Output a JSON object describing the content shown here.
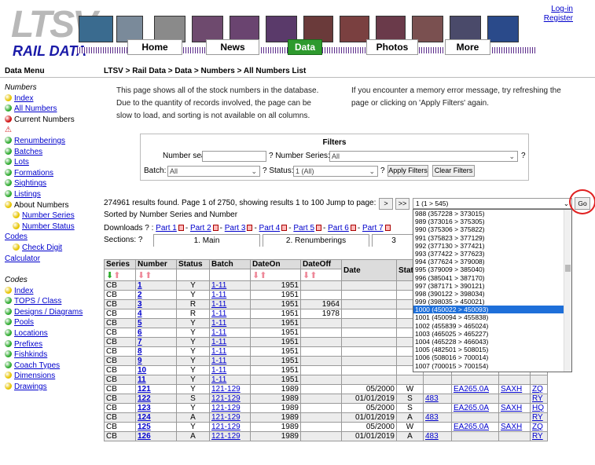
{
  "header": {
    "logo_main": "LTSV",
    "logo_sub": "RAIL DATA",
    "tabs": [
      "Home",
      "News",
      "Data",
      "Photos",
      "More"
    ],
    "login": "Log-in",
    "register": "Register"
  },
  "menu": {
    "title": "Data Menu",
    "sec1": "Numbers",
    "items1": [
      {
        "label": "Index",
        "dot": "yellow",
        "link": true
      },
      {
        "label": "All Numbers",
        "dot": "green",
        "link": true
      },
      {
        "label": "Current Numbers",
        "dot": "red",
        "link": false
      },
      {
        "label": "",
        "dot": "warn",
        "link": false
      },
      {
        "label": "Renumberings",
        "dot": "green",
        "link": true
      },
      {
        "label": "Batches",
        "dot": "green",
        "link": true
      },
      {
        "label": "Lots",
        "dot": "green",
        "link": true
      },
      {
        "label": "Formations",
        "dot": "green",
        "link": true
      },
      {
        "label": "Sightings",
        "dot": "green",
        "link": true
      },
      {
        "label": "Listings",
        "dot": "green",
        "link": true
      },
      {
        "label": "About Numbers",
        "dot": "yellow",
        "link": false
      },
      {
        "label": "Number Series",
        "dot": "yellow",
        "link": true,
        "indent": true
      },
      {
        "label": "Number Status",
        "dot": "yellow",
        "link": true,
        "indent": true
      },
      {
        "label": "Codes",
        "dot": "",
        "link": true
      },
      {
        "label": "Check Digit",
        "dot": "yellow",
        "link": true,
        "indent": true
      },
      {
        "label": "Calculator",
        "dot": "",
        "link": true
      }
    ],
    "sec2": "Codes",
    "items2": [
      {
        "label": "Index",
        "dot": "yellow"
      },
      {
        "label": "TOPS / Class",
        "dot": "green"
      },
      {
        "label": "Designs / Diagrams",
        "dot": "green"
      },
      {
        "label": "Pools",
        "dot": "green"
      },
      {
        "label": "Locations",
        "dot": "green"
      },
      {
        "label": "Prefixes",
        "dot": "green"
      },
      {
        "label": "Fishkinds",
        "dot": "green"
      },
      {
        "label": "Coach Types",
        "dot": "green"
      },
      {
        "label": "Dimensions",
        "dot": "yellow"
      },
      {
        "label": "Drawings",
        "dot": "yellow"
      }
    ]
  },
  "breadcrumb": "LTSV > Rail Data > Data > Numbers > All Numbers List",
  "intro_left": "This page shows all of the stock numbers in the database. Due to the quantity of records involved, the page can be slow to load, and sorting is not available on all columns.",
  "intro_right": "If you encounter a memory error message, try refreshing the page or clicking on 'Apply Filters' again.",
  "filters": {
    "title": "Filters",
    "number_search_label": "Number search:",
    "number_series_label": "? Number Series:",
    "number_series_value": "All",
    "q": "?",
    "batch_label": "Batch:",
    "batch_value": "All",
    "status_label": "? Status:",
    "status_value": "1 (All)",
    "apply": "Apply Filters",
    "clear": "Clear Filters"
  },
  "results": "274961 results found. Page 1 of 2750, showing results 1 to 100  Jump to page:",
  "nav_next": ">",
  "nav_last": ">>",
  "jump_value": "1 (1 > 545)",
  "go": "Go",
  "sorted": "Sorted by Number Series and Number",
  "downloads": {
    "label": "Downloads ? :",
    "parts": [
      "Part 1",
      "Part 2",
      "Part 3",
      "Part 4",
      "Part 5",
      "Part 6",
      "Part 7"
    ]
  },
  "sections": {
    "label": "Sections: ?",
    "tabs": [
      "1. Main",
      "2. Renumberings",
      "3"
    ]
  },
  "dropdown": {
    "options": [
      "988 (357228 > 373015)",
      "989 (373016 > 375305)",
      "990 (375306 > 375822)",
      "991 (375823 > 377129)",
      "992 (377130 > 377421)",
      "993 (377422 > 377623)",
      "994 (377624 > 379008)",
      "995 (379009 > 385040)",
      "996 (385041 > 387170)",
      "997 (387171 > 390121)",
      "998 (390122 > 398034)",
      "999 (398035 > 450021)",
      "1000 (450022 > 450093)",
      "1001 (450094 > 455838)",
      "1002 (455839 > 465024)",
      "1003 (465025 > 465227)",
      "1004 (465228 > 466043)",
      "1005 (482501 > 508015)",
      "1006 (508016 > 700014)",
      "1007 (700015 > 700154)"
    ],
    "selected": 12
  },
  "table": {
    "headers": [
      "Series",
      "Number",
      "Status",
      "Batch",
      "DateOn",
      "DateOff",
      "Date",
      "Stat",
      "",
      "",
      "",
      "oc"
    ],
    "rows": [
      [
        "CB",
        "1",
        "Y",
        "1-11",
        "1951",
        "",
        "",
        "",
        "",
        "",
        "",
        ""
      ],
      [
        "CB",
        "2",
        "Y",
        "1-11",
        "1951",
        "",
        "",
        "",
        "",
        "",
        "",
        ""
      ],
      [
        "CB",
        "3",
        "R",
        "1-11",
        "1951",
        "1964",
        "",
        "",
        "",
        "",
        "",
        ""
      ],
      [
        "CB",
        "4",
        "R",
        "1-11",
        "1951",
        "1978",
        "",
        "",
        "",
        "",
        "",
        ""
      ],
      [
        "CB",
        "5",
        "Y",
        "1-11",
        "1951",
        "",
        "",
        "",
        "",
        "",
        "",
        ""
      ],
      [
        "CB",
        "6",
        "Y",
        "1-11",
        "1951",
        "",
        "",
        "",
        "",
        "",
        "",
        ""
      ],
      [
        "CB",
        "7",
        "Y",
        "1-11",
        "1951",
        "",
        "",
        "",
        "",
        "",
        "",
        ""
      ],
      [
        "CB",
        "8",
        "Y",
        "1-11",
        "1951",
        "",
        "",
        "",
        "",
        "",
        "",
        ""
      ],
      [
        "CB",
        "9",
        "Y",
        "1-11",
        "1951",
        "",
        "",
        "",
        "",
        "",
        "",
        ""
      ],
      [
        "CB",
        "10",
        "Y",
        "1-11",
        "1951",
        "",
        "",
        "",
        "",
        "",
        "",
        ""
      ],
      [
        "CB",
        "11",
        "Y",
        "1-11",
        "1951",
        "",
        "",
        "",
        "",
        "",
        "",
        ""
      ],
      [
        "CB",
        "121",
        "Y",
        "121-129",
        "1989",
        "",
        "05/2000",
        "W",
        "",
        "EA265.0A",
        "SAXH",
        "ZQ"
      ],
      [
        "CB",
        "122",
        "S",
        "121-129",
        "1989",
        "",
        "01/01/2019",
        "S",
        "483",
        "",
        "",
        "RY"
      ],
      [
        "CB",
        "123",
        "Y",
        "121-129",
        "1989",
        "",
        "05/2000",
        "S",
        "",
        "EA265.0A",
        "SAXH",
        "HQ"
      ],
      [
        "CB",
        "124",
        "A",
        "121-129",
        "1989",
        "",
        "01/01/2019",
        "A",
        "483",
        "",
        "",
        "RY"
      ],
      [
        "CB",
        "125",
        "Y",
        "121-129",
        "1989",
        "",
        "05/2000",
        "W",
        "",
        "EA265.0A",
        "SAXH",
        "ZQ"
      ],
      [
        "CB",
        "126",
        "A",
        "121-129",
        "1989",
        "",
        "01/01/2019",
        "A",
        "483",
        "",
        "",
        "RY"
      ]
    ]
  }
}
